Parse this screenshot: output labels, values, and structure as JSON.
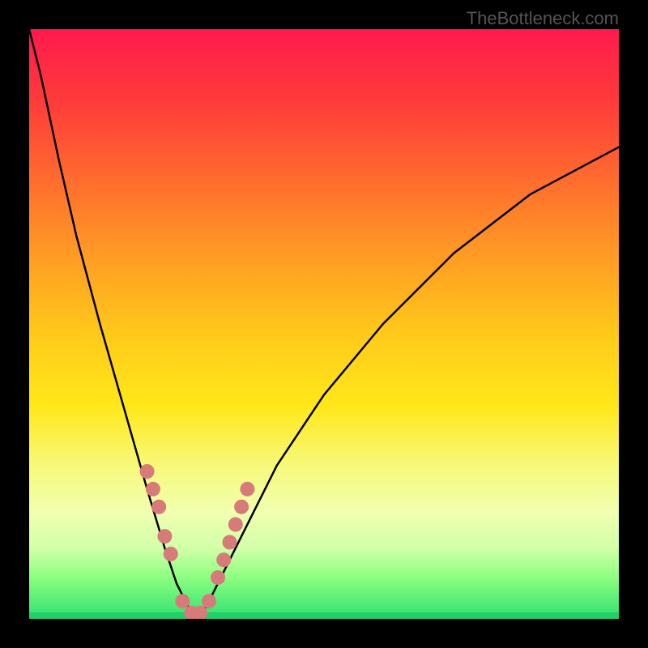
{
  "watermark": {
    "text": "TheBottleneck.com"
  },
  "chart_data": {
    "type": "line",
    "title": "",
    "xlabel": "",
    "ylabel": "",
    "xlim": [
      0,
      100
    ],
    "ylim": [
      0,
      100
    ],
    "series": [
      {
        "name": "curve",
        "color": "#000000",
        "x": [
          0,
          2,
          5,
          8,
          12,
          16,
          20,
          23,
          25,
          27,
          28.5,
          30,
          32,
          36,
          42,
          50,
          60,
          72,
          85,
          100
        ],
        "y": [
          100,
          92,
          78,
          65,
          50,
          36,
          22,
          12,
          6,
          2,
          0.5,
          2,
          6,
          14,
          26,
          38,
          50,
          62,
          72,
          80
        ]
      }
    ],
    "markers": {
      "name": "highlight-points",
      "color": "#d77a7a",
      "x": [
        20,
        21,
        22,
        23,
        24,
        26,
        27.5,
        29,
        30.5,
        32,
        33,
        34,
        35,
        36,
        37
      ],
      "y": [
        25,
        22,
        19,
        14,
        11,
        3,
        1,
        1,
        3,
        7,
        10,
        13,
        16,
        19,
        22
      ]
    }
  }
}
